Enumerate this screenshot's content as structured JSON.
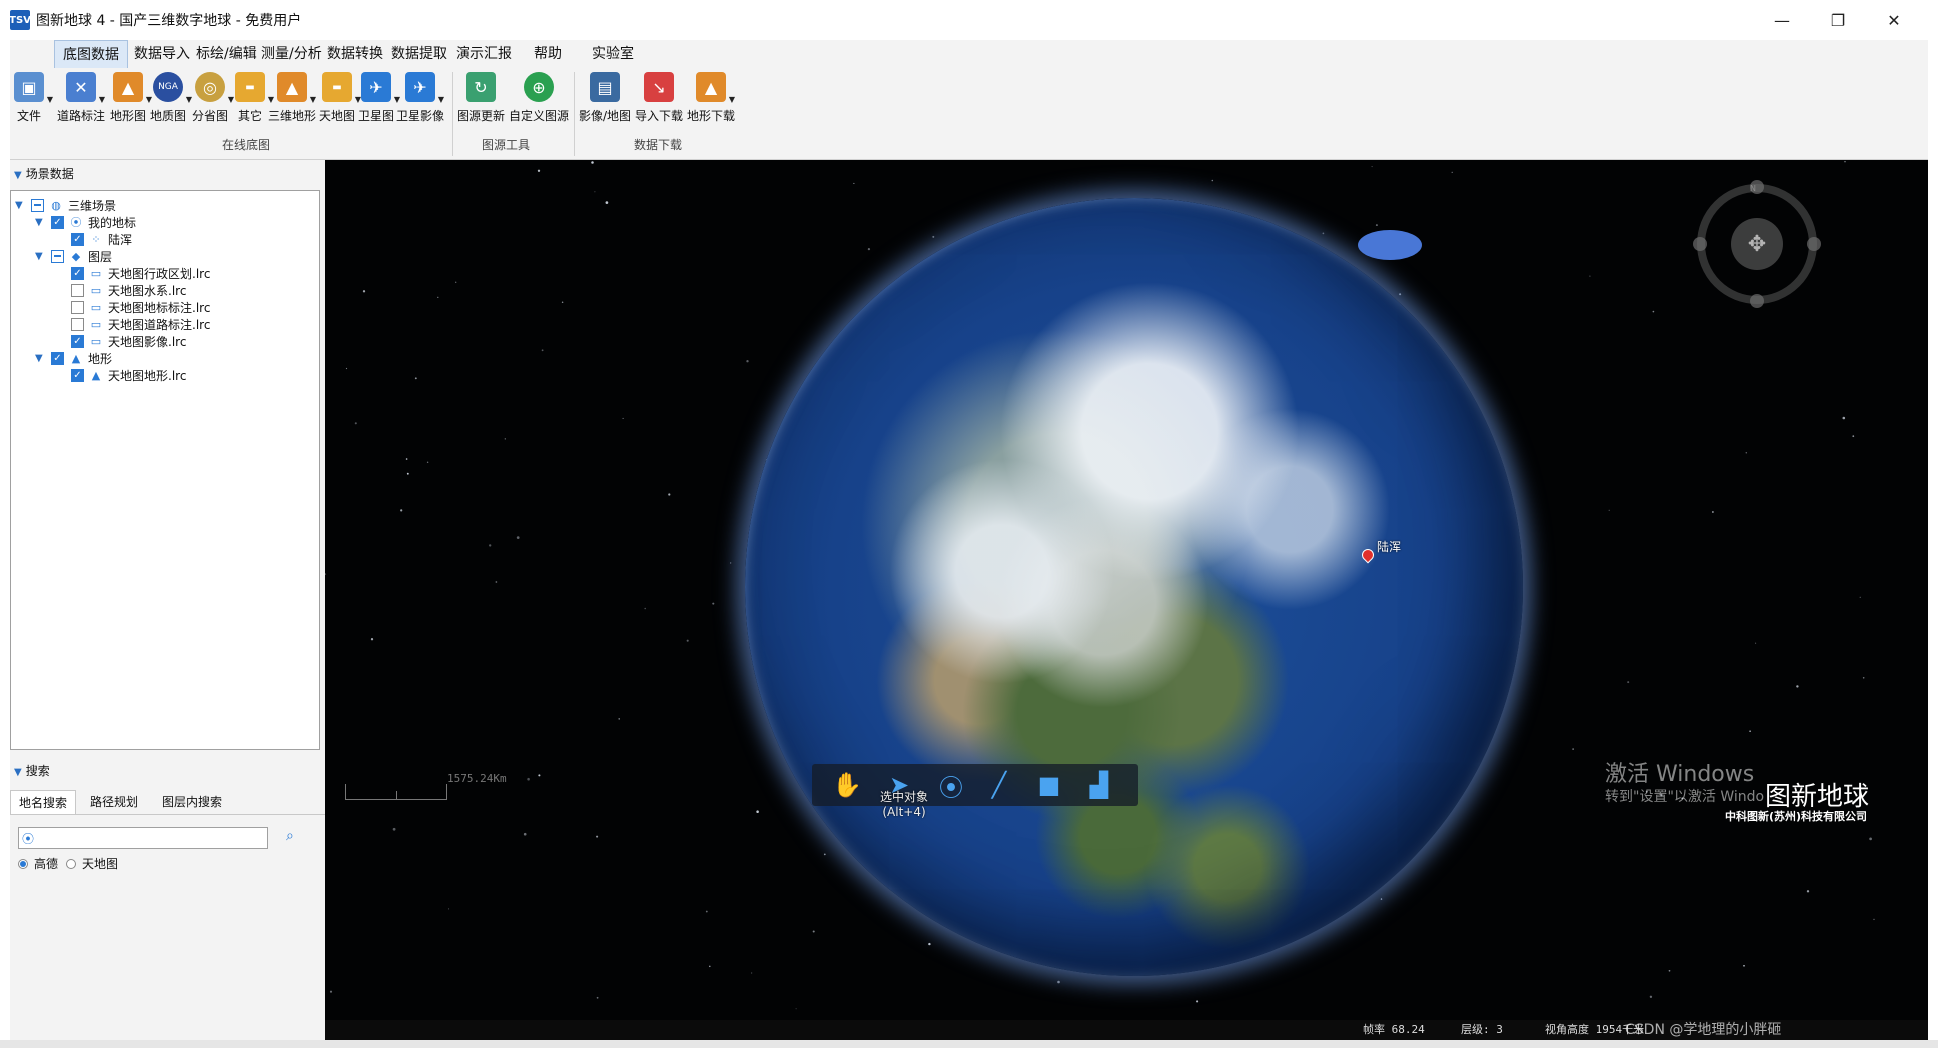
{
  "window": {
    "icon_text": "TSV",
    "title": "图新地球 4 - 国产三维数字地球 - 免费用户",
    "minimize": "—",
    "maximize": "❐",
    "close": "✕"
  },
  "menu": {
    "tabs": [
      "底图数据",
      "数据导入",
      "标绘/编辑",
      "测量/分析",
      "数据转换",
      "数据提取",
      "演示汇报",
      "帮助",
      "实验室"
    ],
    "active_tab": "底图数据"
  },
  "ribbon": {
    "file_label": "文件",
    "buttons": [
      {
        "label": "道路标注",
        "icon": "road-icon",
        "color": "#4a7fd0"
      },
      {
        "label": "地形图",
        "icon": "terrain-map-icon",
        "color": "#e08a2a"
      },
      {
        "label": "地质图",
        "icon": "geology-icon",
        "color": "#2a4fa0"
      },
      {
        "label": "分省图",
        "icon": "province-icon",
        "color": "#c8a040"
      },
      {
        "label": "其它",
        "icon": "other-icon",
        "color": "#e6a830"
      },
      {
        "label": "三维地形",
        "icon": "3d-terrain-icon",
        "color": "#e08a2a"
      },
      {
        "label": "天地图",
        "icon": "tianditu-icon",
        "color": "#e6a830"
      },
      {
        "label": "卫星图",
        "icon": "satellite-icon",
        "color": "#2a7ad5"
      },
      {
        "label": "卫星影像",
        "icon": "satellite-image-icon",
        "color": "#2a7ad5"
      },
      {
        "label": "图源更新",
        "icon": "source-update-icon",
        "color": "#3aa070"
      },
      {
        "label": "自定义图源",
        "icon": "custom-source-icon",
        "color": "#2aa050"
      },
      {
        "label": "影像/地图",
        "icon": "image-map-icon",
        "color": "#3a6aa0"
      },
      {
        "label": "导入下载",
        "icon": "import-download-icon",
        "color": "#d84040"
      },
      {
        "label": "地形下载",
        "icon": "terrain-download-icon",
        "color": "#e08a2a"
      }
    ],
    "groups": [
      "在线底图",
      "图源工具",
      "数据下载"
    ]
  },
  "scene_panel": {
    "header": "场景数据",
    "tree": [
      {
        "label": "三维场景",
        "icon": "globe-icon",
        "state": "partial"
      },
      {
        "label": "我的地标",
        "icon": "pin-icon",
        "state": "checked"
      },
      {
        "label": "陆浑",
        "icon": "point-icon",
        "state": "checked"
      },
      {
        "label": "图层",
        "icon": "layers-icon",
        "state": "partial"
      },
      {
        "label": "天地图行政区划.lrc",
        "icon": "monitor-icon",
        "state": "checked"
      },
      {
        "label": "天地图水系.lrc",
        "icon": "monitor-icon",
        "state": "unchecked"
      },
      {
        "label": "天地图地标标注.lrc",
        "icon": "monitor-icon",
        "state": "unchecked"
      },
      {
        "label": "天地图道路标注.lrc",
        "icon": "monitor-icon",
        "state": "unchecked"
      },
      {
        "label": "天地图影像.lrc",
        "icon": "monitor-icon",
        "state": "checked"
      },
      {
        "label": "地形",
        "icon": "terrain-icon",
        "state": "checked"
      },
      {
        "label": "天地图地形.lrc",
        "icon": "terrain-icon",
        "state": "checked"
      }
    ]
  },
  "search_panel": {
    "header": "搜索",
    "tabs": [
      "地名搜索",
      "路径规划",
      "图层内搜索"
    ],
    "active_tab": "地名搜索",
    "input_value": "",
    "input_placeholder": "",
    "options": [
      {
        "label": "高德",
        "selected": true
      },
      {
        "label": "天地图",
        "selected": false
      }
    ]
  },
  "viewport": {
    "marker_label": "陆浑",
    "scale_label": "1575.24Km",
    "tooltip_line1": "选中对象",
    "tooltip_line2": "(Alt+4)",
    "tools": [
      "hand-icon",
      "select-pointer-icon",
      "placemark-icon",
      "line-icon",
      "polygon-icon",
      "chart-add-icon"
    ],
    "watermark_line1": "激活 Windows",
    "watermark_line2": "转到\"设置\"以激活 Windo",
    "brand_name": "图新地球",
    "brand_company": "中科图新(苏州)科技有限公司",
    "status": {
      "fps": "帧率 68.24",
      "level": "层级: 3",
      "view": "视角高度 1954千米",
      "csdn": "CSDN @学地理的小胖砸"
    }
  }
}
